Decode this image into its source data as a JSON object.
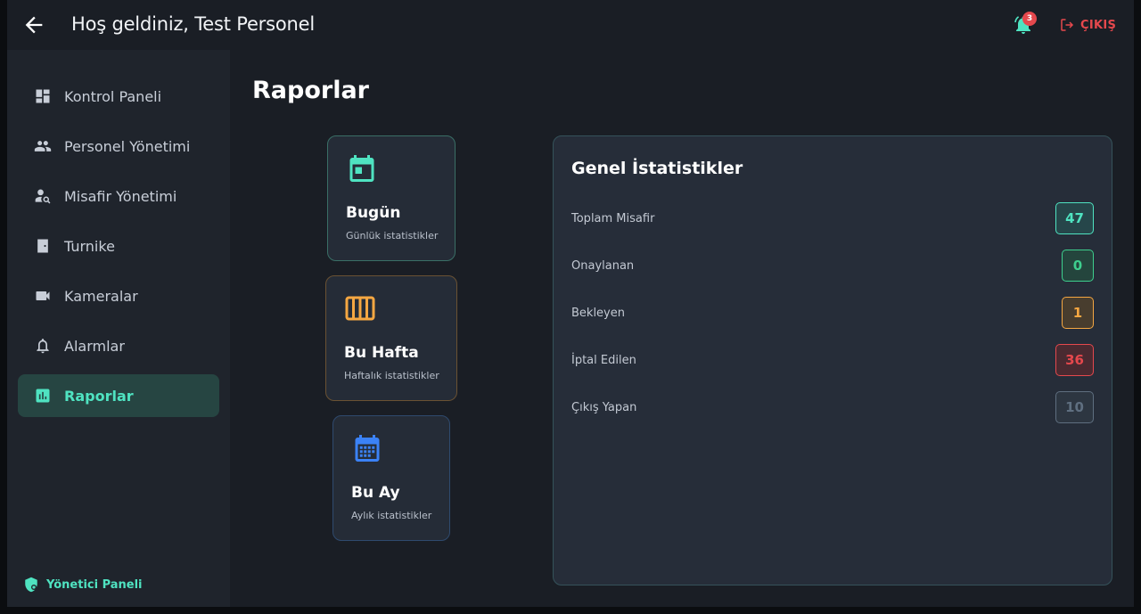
{
  "header": {
    "title": "Hoş geldiniz, Test Personel",
    "notification_count": "3",
    "logout_label": "ÇIKIŞ"
  },
  "sidebar": {
    "items": [
      {
        "label": "Kontrol Paneli",
        "icon": "dashboard-icon"
      },
      {
        "label": "Personel Yönetimi",
        "icon": "people-icon"
      },
      {
        "label": "Misafir Yönetimi",
        "icon": "guest-search-icon"
      },
      {
        "label": "Turnike",
        "icon": "door-icon"
      },
      {
        "label": "Kameralar",
        "icon": "camera-icon"
      },
      {
        "label": "Alarmlar",
        "icon": "bell-icon"
      },
      {
        "label": "Raporlar",
        "icon": "bar-chart-icon",
        "active": true
      }
    ],
    "footer_label": "Yönetici Paneli"
  },
  "main": {
    "title": "Raporlar",
    "periods": [
      {
        "title": "Bugün",
        "subtitle": "Günlük istatistikler",
        "color": "#4fe3c1"
      },
      {
        "title": "Bu Hafta",
        "subtitle": "Haftalık istatistikler",
        "color": "#f5a742"
      },
      {
        "title": "Bu Ay",
        "subtitle": "Aylık istatistikler",
        "color": "#3b82f6"
      }
    ],
    "stats": {
      "title": "Genel İstatistikler",
      "rows": [
        {
          "label": "Toplam Misafir",
          "value": "47",
          "color": "#4fe3c1"
        },
        {
          "label": "Onaylanan",
          "value": "0",
          "color": "#3ecf8e"
        },
        {
          "label": "Bekleyen",
          "value": "1",
          "color": "#f5a742"
        },
        {
          "label": "İptal Edilen",
          "value": "36",
          "color": "#e5484d"
        },
        {
          "label": "Çıkış Yapan",
          "value": "10",
          "color": "#5f6f80"
        }
      ]
    }
  },
  "colors": {
    "accent": "#4fe3c1",
    "danger": "#e5484d",
    "background": "#1a1e25",
    "sidebar": "#1f242c"
  }
}
